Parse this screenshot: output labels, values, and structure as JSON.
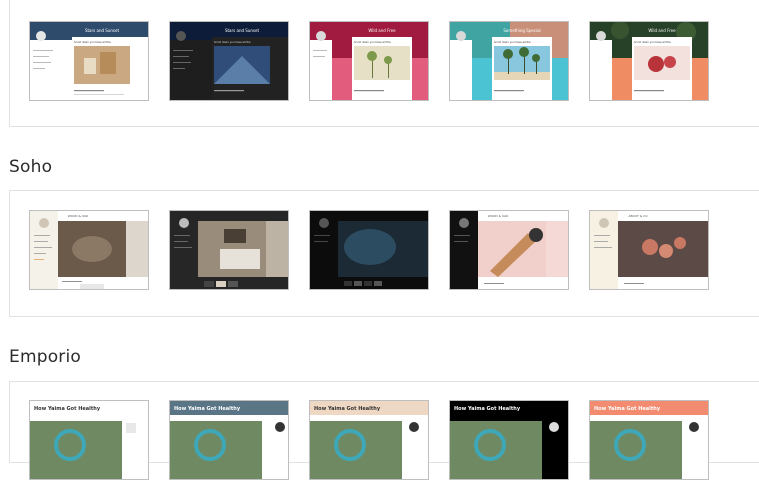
{
  "sections": [
    {
      "name": "",
      "themes": [
        {
          "variant": "light",
          "title": "Stars and Sunset",
          "post": "Scroll down you have all the",
          "accent": "#1f2f48",
          "side": "#ffffff",
          "bottom": "#ffffff",
          "scene": "#c9a882"
        },
        {
          "variant": "dark",
          "title": "Stars and Sunset",
          "post": "Scroll down you have all the",
          "accent": "#0d1c38",
          "side": "#1e1e1e",
          "bottom": "#2a2a2a",
          "scene": "#2f4d78"
        },
        {
          "variant": "crimson",
          "title": "Wild and Free",
          "post": "Scroll down you have all the",
          "accent": "#a01b3f",
          "side": "#ffffff",
          "bottom": "#e25c7e",
          "scene": "#e6e0c7"
        },
        {
          "variant": "teal",
          "title": "Something Special",
          "post": "Scroll down you have all the",
          "accent": "#3fa4a2",
          "side": "#ffffff",
          "bottom": "#4cc3d3",
          "scene": "#88c7dd"
        },
        {
          "variant": "coral",
          "title": "Wild and Free",
          "post": "Scroll down you have all the",
          "accent": "#274028",
          "side": "#ffffff",
          "bottom": "#f08c63",
          "scene": "#f2e1dc"
        }
      ]
    },
    {
      "name": "Soho",
      "themes": [
        {
          "variant": "soho-light",
          "brand": "WOOD & OAK",
          "side": "#f5f2ea",
          "scene": "#6b5a4a"
        },
        {
          "variant": "soho-dark",
          "brand": "",
          "side": "#262626",
          "scene": "#9a8c7a"
        },
        {
          "variant": "soho-black",
          "brand": "",
          "side": "#0c0c0c",
          "scene": "#1c2a36"
        },
        {
          "variant": "soho-pink",
          "brand": "WOOD & OAK",
          "side": "#111111",
          "scene": "#f1cfcb"
        },
        {
          "variant": "soho-cream",
          "brand": "ABOUT & CO",
          "side": "#f7f1e3",
          "scene": "#5b4a45"
        }
      ]
    },
    {
      "name": "Emporio",
      "themes": [
        {
          "variant": "emporio-white",
          "headline": "How Yaima Got Healthy",
          "header": "#ffffff",
          "text": "#333333"
        },
        {
          "variant": "emporio-slate",
          "headline": "How Yaima Got Healthy",
          "header": "#5a7686",
          "text": "#ffffff"
        },
        {
          "variant": "emporio-sand",
          "headline": "How Yaima Got Healthy",
          "header": "#efd8c3",
          "text": "#333333"
        },
        {
          "variant": "emporio-black",
          "headline": "How Yaima Got Healthy",
          "header": "#000000",
          "text": "#ffffff"
        },
        {
          "variant": "emporio-salmon",
          "headline": "How Yaima Got Healthy",
          "header": "#f28b70",
          "text": "#ffffff"
        }
      ]
    }
  ]
}
